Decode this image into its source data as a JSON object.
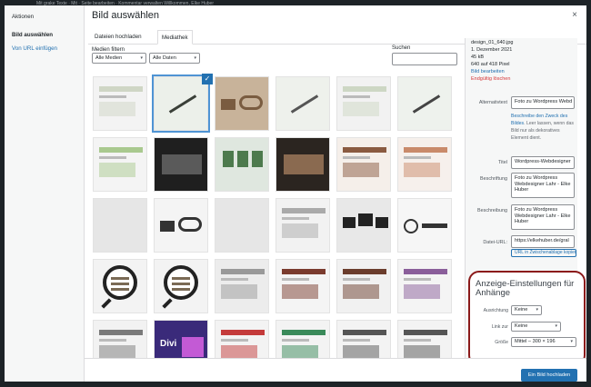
{
  "admin_bar": {
    "text": "Mit grake  Texte  ·  Mit  ·  Seite bearbeiten   ·  Kommentar verwalten                                              Willkommen, Elke Huber"
  },
  "menu": {
    "actions_label": "Aktionen",
    "items": [
      "Bild auswählen",
      "Von URL einfügen"
    ]
  },
  "modal": {
    "title": "Bild auswählen",
    "close": "×"
  },
  "tabs": [
    "Dateien hochladen",
    "Mediathek"
  ],
  "filters": {
    "label": "Medien filtern",
    "type_value": "Alle Medien",
    "date_value": "Alle Daten",
    "search_label": "Suchen",
    "search_value": ""
  },
  "attachment": {
    "filename": "design_01_640.jpg",
    "date": "1. Dezember 2021",
    "size": "45 kB",
    "dimensions": "640 auf 418 Pixel",
    "edit_link": "Bild bearbeiten",
    "delete_link": "Endgültig löschen",
    "alt_label": "Alternativtext",
    "alt_value": "Foto zu Wordpress Webd",
    "alt_help_link": "Beschreibe den Zweck des Bildes",
    "alt_help_text": ". Leer lassen, wenn das Bild nur als dekoratives Element dient.",
    "title_label": "Titel",
    "title_value": "Wordpress-Webdesigner",
    "caption_label": "Beschriftung",
    "caption_value": "Foto zu Wordpress Webdesigner Lahr - Elke Huber",
    "description_label": "Beschreibung",
    "description_value": "Foto zu Wordpress Webdesigner Lahr - Elke Huber",
    "url_label": "Datei-URL:",
    "url_value": "https://elkehuber.de/gral",
    "copy_button": "URL in Zwischenablage kopieren"
  },
  "display_settings": {
    "heading": "Anzeige-Einstellungen für Anhänge",
    "alignment_label": "Ausrichtung",
    "alignment_value": "Keine",
    "link_label": "Link zur",
    "link_value": "Keine",
    "size_label": "Größe",
    "size_value": "Mittel – 300 × 196"
  },
  "footer": {
    "insert_button": "Ein Bild hochladen"
  },
  "thumbnails": [
    {
      "bg": "#f3f3f3",
      "fg": "#cfd6c5",
      "kind": "site"
    },
    {
      "bg": "#ecf0ea",
      "fg": "#3a3f38",
      "kind": "pen"
    },
    {
      "bg": "#c8b39a",
      "fg": "#7a5c40",
      "kind": "desk"
    },
    {
      "bg": "#eef1ec",
      "fg": "#555",
      "kind": "pen"
    },
    {
      "bg": "#f2f2f2",
      "fg": "#cdd7c4",
      "kind": "site"
    },
    {
      "bg": "#eef2ed",
      "fg": "#444",
      "kind": "pen"
    },
    {
      "bg": "#f4f4f4",
      "fg": "#a9c98f",
      "kind": "site"
    },
    {
      "bg": "#1f1f1f",
      "fg": "#5a5a5a",
      "kind": "dark"
    },
    {
      "bg": "#dfe7df",
      "fg": "#4d7a4d",
      "kind": "people"
    },
    {
      "bg": "#2b2520",
      "fg": "#8a6a50",
      "kind": "dark"
    },
    {
      "bg": "#f5efea",
      "fg": "#8a5a40",
      "kind": "site"
    },
    {
      "bg": "#f6f0ec",
      "fg": "#c98a6a",
      "kind": "site"
    },
    {
      "bg": "#e6e6e6",
      "fg": "#c0c0c0",
      "kind": "blank"
    },
    {
      "bg": "#f4f4f4",
      "fg": "#333",
      "kind": "desk2"
    },
    {
      "bg": "#e6e6e6",
      "fg": "#c0c0c0",
      "kind": "blank"
    },
    {
      "bg": "#f2f2f2",
      "fg": "#aaa",
      "kind": "site"
    },
    {
      "bg": "#e8e8e8",
      "fg": "#222",
      "kind": "screens"
    },
    {
      "bg": "#f6f6f6",
      "fg": "#333",
      "kind": "logo"
    },
    {
      "bg": "#f3f3f3",
      "fg": "#7a6a55",
      "kind": "icon"
    },
    {
      "bg": "#f3f3f3",
      "fg": "#7a6a55",
      "kind": "icon"
    },
    {
      "bg": "#ececec",
      "fg": "#999",
      "kind": "site"
    },
    {
      "bg": "#f4f4f4",
      "fg": "#7a3b2e",
      "kind": "site"
    },
    {
      "bg": "#f1f1f1",
      "fg": "#6b3d2d",
      "kind": "site"
    },
    {
      "bg": "#f4f4f4",
      "fg": "#8a5e9a",
      "kind": "site"
    },
    {
      "bg": "#f2f2f2",
      "fg": "#7a7a7a",
      "kind": "site"
    },
    {
      "bg": "#3a2a7a",
      "fg": "#c35ad5",
      "kind": "divi"
    },
    {
      "bg": "#f3f3f3",
      "fg": "#c43b3b",
      "kind": "site"
    },
    {
      "bg": "#f3f3f3",
      "fg": "#3a8a5a",
      "kind": "site"
    },
    {
      "bg": "#f3f3f3",
      "fg": "#555",
      "kind": "site"
    },
    {
      "bg": "#f3f3f3",
      "fg": "#555",
      "kind": "site"
    }
  ],
  "divi_label": "Divi",
  "selected_mark": "✓"
}
